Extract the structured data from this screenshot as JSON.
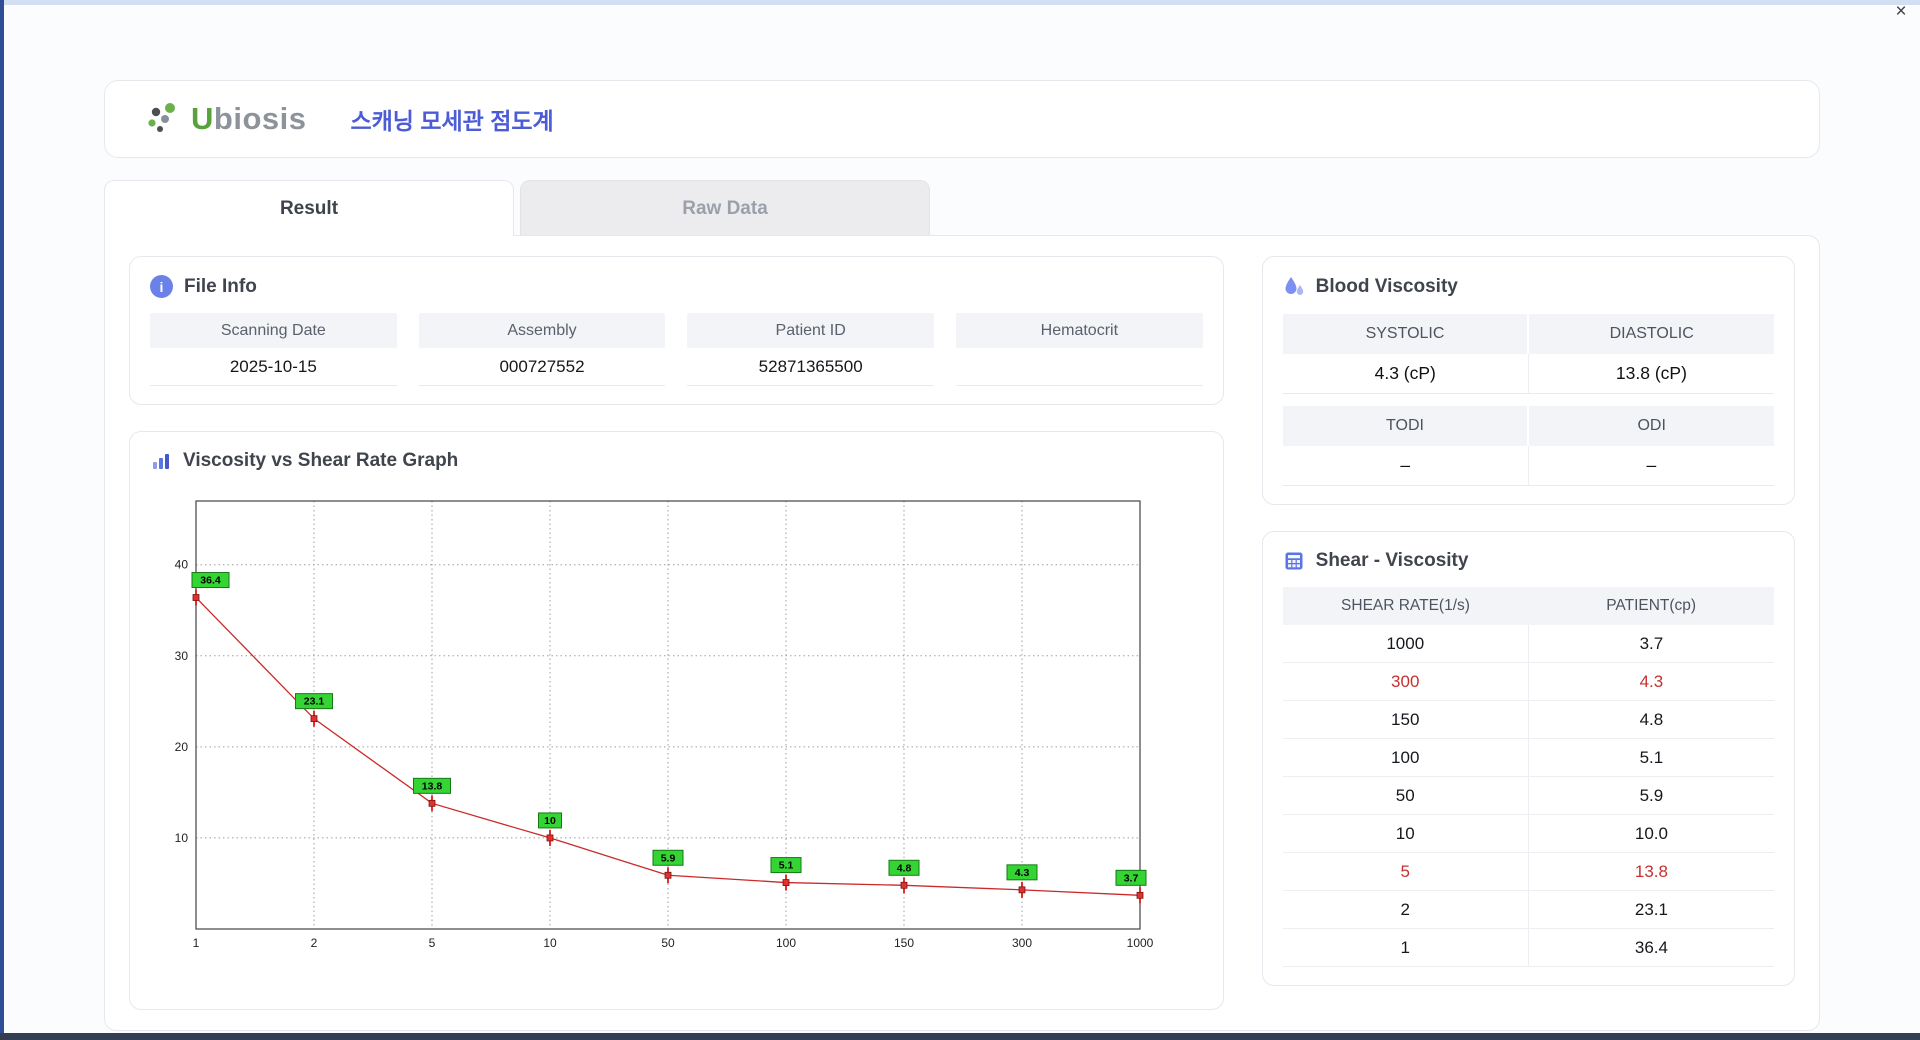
{
  "window": {
    "close_label": "×"
  },
  "header": {
    "brand": "Ubiosis",
    "title": "스캐닝 모세관 점도계"
  },
  "tabs": {
    "result": "Result",
    "raw_data": "Raw Data"
  },
  "file_info": {
    "title": "File Info",
    "fields": [
      {
        "label": "Scanning Date",
        "value": "2025-10-15"
      },
      {
        "label": "Assembly",
        "value": "000727552"
      },
      {
        "label": "Patient ID",
        "value": "52871365500"
      },
      {
        "label": "Hematocrit",
        "value": ""
      }
    ]
  },
  "blood_viscosity": {
    "title": "Blood Viscosity",
    "groups": [
      {
        "headers": [
          "SYSTOLIC",
          "DIASTOLIC"
        ],
        "values": [
          "4.3 (cP)",
          "13.8 (cP)"
        ]
      },
      {
        "headers": [
          "TODI",
          "ODI"
        ],
        "values": [
          "–",
          "–"
        ]
      }
    ]
  },
  "shear_viscosity": {
    "title": "Shear - Viscosity",
    "columns": [
      "SHEAR RATE(1/s)",
      "PATIENT(cp)"
    ],
    "rows": [
      {
        "shear_rate": "1000",
        "patient": "3.7",
        "highlight": false
      },
      {
        "shear_rate": "300",
        "patient": "4.3",
        "highlight": true
      },
      {
        "shear_rate": "150",
        "patient": "4.8",
        "highlight": false
      },
      {
        "shear_rate": "100",
        "patient": "5.1",
        "highlight": false
      },
      {
        "shear_rate": "50",
        "patient": "5.9",
        "highlight": false
      },
      {
        "shear_rate": "10",
        "patient": "10.0",
        "highlight": false
      },
      {
        "shear_rate": "5",
        "patient": "13.8",
        "highlight": true
      },
      {
        "shear_rate": "2",
        "patient": "23.1",
        "highlight": false
      },
      {
        "shear_rate": "1",
        "patient": "36.4",
        "highlight": false
      }
    ]
  },
  "graph": {
    "title": "Viscosity vs Shear Rate Graph"
  },
  "chart_data": {
    "type": "line",
    "title": "Viscosity vs Shear Rate Graph",
    "x": [
      1,
      2,
      5,
      10,
      50,
      100,
      150,
      300,
      1000
    ],
    "x_tick_labels": [
      "1",
      "2",
      "5",
      "10",
      "50",
      "100",
      "150",
      "300",
      "1000"
    ],
    "values": [
      36.4,
      23.1,
      13.8,
      10,
      5.9,
      5.1,
      4.8,
      4.3,
      3.7
    ],
    "point_labels": [
      "36.4",
      "23.1",
      "13.8",
      "10",
      "5.9",
      "5.1",
      "4.8",
      "4.3",
      "3.7"
    ],
    "y_ticks": [
      10,
      20,
      30,
      40
    ],
    "ylim": [
      0,
      47
    ],
    "x_spacing": "even",
    "grid": "dotted",
    "xlabel": "",
    "ylabel": "",
    "line_color": "#c92a2a",
    "marker_color": "#e03131",
    "marker_edge": "#7e1212",
    "label_bg": "#35d435",
    "label_border": "#157a15",
    "grid_color": "#9aa0a6"
  }
}
